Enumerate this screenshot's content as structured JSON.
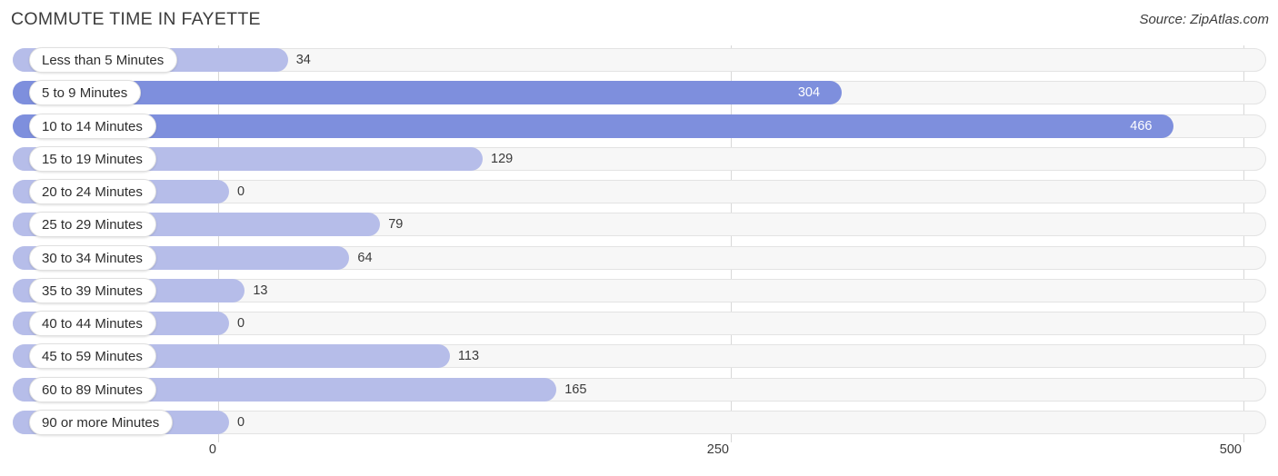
{
  "header": {
    "title": "COMMUTE TIME IN FAYETTE",
    "source": "Source: ZipAtlas.com"
  },
  "colors": {
    "bar_light": "#b6bde9",
    "bar_dark": "#7e8fdd",
    "track": "#f7f7f7",
    "gridline": "#d8d8d8",
    "text": "#3a3a3a"
  },
  "axis": {
    "ticks": [
      "0",
      "250",
      "500"
    ],
    "min": 0,
    "max": 500
  },
  "chart_data": {
    "type": "bar",
    "orientation": "horizontal",
    "title": "COMMUTE TIME IN FAYETTE",
    "subtitle": "Source: ZipAtlas.com",
    "xlabel": "",
    "ylabel": "",
    "xlim": [
      0,
      500
    ],
    "grid": true,
    "legend": null,
    "categories": [
      "Less than 5 Minutes",
      "5 to 9 Minutes",
      "10 to 14 Minutes",
      "15 to 19 Minutes",
      "20 to 24 Minutes",
      "25 to 29 Minutes",
      "30 to 34 Minutes",
      "35 to 39 Minutes",
      "40 to 44 Minutes",
      "45 to 59 Minutes",
      "60 to 89 Minutes",
      "90 or more Minutes"
    ],
    "values": [
      34,
      304,
      466,
      129,
      0,
      79,
      64,
      13,
      0,
      113,
      165,
      0
    ],
    "value_labels": [
      "34",
      "304",
      "466",
      "129",
      "0",
      "79",
      "64",
      "13",
      "0",
      "113",
      "165",
      "0"
    ],
    "tick_labels": [
      "0",
      "250",
      "500"
    ],
    "tick_values": [
      0,
      250,
      500
    ]
  }
}
